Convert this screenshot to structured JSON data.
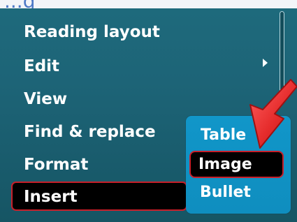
{
  "top_strip_text": "...g",
  "menu": {
    "items": [
      {
        "label": "Reading layout"
      },
      {
        "label": "Edit"
      },
      {
        "label": "View"
      },
      {
        "label": "Find & replace"
      },
      {
        "label": "Format"
      },
      {
        "label": "Insert"
      }
    ]
  },
  "submenu": {
    "items": [
      {
        "label": "Table"
      },
      {
        "label": "Image"
      },
      {
        "label": "Bullet"
      }
    ]
  },
  "colors": {
    "menu_background": "#1d6477",
    "submenu_background": "#1196c9",
    "selection_background": "#000000",
    "selection_border": "#c81f2a",
    "arrow_red": "#e62c2c",
    "text_white": "#ffffff"
  },
  "icons": {
    "submenu_arrow": "chevron-right-icon",
    "pointer": "red-arrow-icon"
  }
}
